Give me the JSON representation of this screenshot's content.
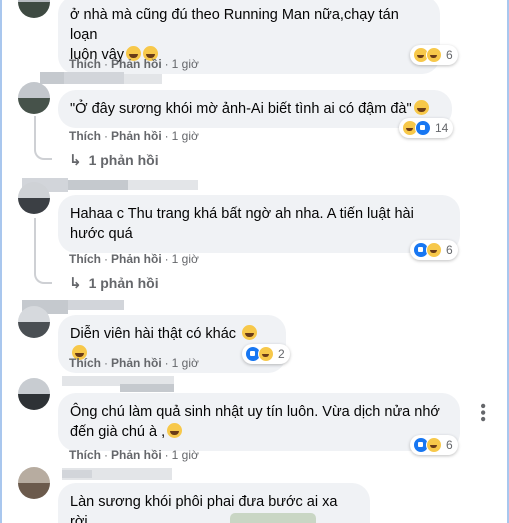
{
  "actions": {
    "like": "Thích",
    "reply": "Phản hồi",
    "sep": "·"
  },
  "comments": [
    {
      "text": "ở nhà mà cũng đú theo Running Man nữa,chạy tán loạn\nluôn vậy",
      "time": "1 giờ",
      "reactions": [
        "haha",
        "haha"
      ],
      "count": "6",
      "replies": ""
    },
    {
      "text": "\"Ở đây sương khói mờ ảnh-Ai biết tình ai có đậm đà\"",
      "time": "1 giờ",
      "reactions": [
        "haha",
        "like"
      ],
      "count": "14",
      "replies": "1 phản hồi"
    },
    {
      "text": "Hahaa c Thu trang khá bất ngờ ah nha. A tiến luật hài\nhước quá",
      "time": "1 giờ",
      "reactions": [
        "like",
        "haha"
      ],
      "count": "6",
      "replies": "1 phản hồi"
    },
    {
      "text": "Diễn viên hài thật có khác",
      "time": "1 giờ",
      "reactions": [
        "like",
        "haha"
      ],
      "count": "2",
      "replies": ""
    },
    {
      "text": "Ông chú làm quả sinh nhật uy tín luôn. Vừa dịch nửa nhớ\nđến già chú à ,",
      "time": "1 giờ",
      "reactions": [
        "like",
        "haha"
      ],
      "count": "6",
      "replies": ""
    },
    {
      "text": "Làn sương khói phôi phai đưa bước ai xa rời",
      "time": "",
      "reactions": [],
      "count": "",
      "replies": ""
    }
  ],
  "more_icon": "more-horizontal-icon",
  "colors": {
    "bubble": "#f0f2f5",
    "meta": "#65676b",
    "like": "#1877f2",
    "haha": "#f7c84a"
  }
}
